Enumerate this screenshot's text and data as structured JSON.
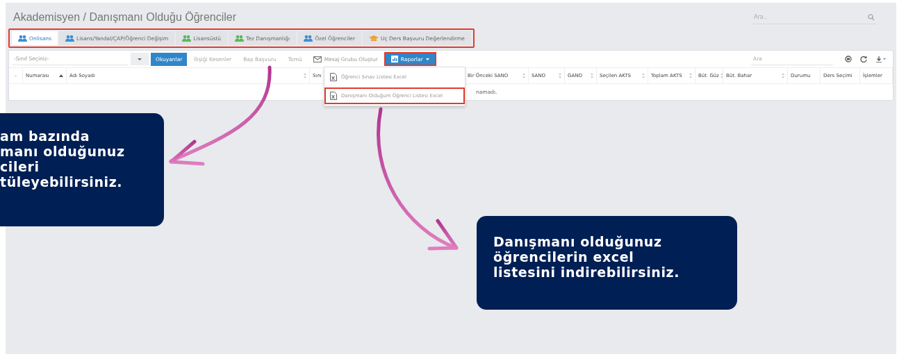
{
  "page_title": "Akademisyen / Danışmanı Olduğu Öğrenciler",
  "top_search": {
    "placeholder": "Ara.."
  },
  "tab_bar": {
    "highlighted": true,
    "tabs": [
      {
        "label": "Onlisans",
        "selected": true,
        "kind": "people",
        "color": "#3a8fd8"
      },
      {
        "label": "Lisans/Yandal/ÇAP/Öğrenci Değişim",
        "selected": false,
        "kind": "people",
        "color": "#3a8fd8"
      },
      {
        "label": "Lisansüstü",
        "selected": false,
        "kind": "people",
        "color": "#5cb85c"
      },
      {
        "label": "Tez Danışmanlığı",
        "selected": false,
        "kind": "people",
        "color": "#5cb85c"
      },
      {
        "label": "Özel Öğrenciler",
        "selected": false,
        "kind": "people",
        "color": "#3a8fd8"
      },
      {
        "label": "Uç Ders Başvuru Değerlendirme",
        "selected": false,
        "kind": "hat",
        "color": "#f0a030"
      }
    ]
  },
  "toolbar": {
    "class_select": {
      "placeholder": "-Sınıf Seçiniz-"
    },
    "filters": [
      {
        "label": "Okuyanlar",
        "selected": true
      },
      {
        "label": "İlişiği Kesenler",
        "selected": false
      },
      {
        "label": "Bap Başvuru",
        "selected": false
      },
      {
        "label": "Tomü",
        "selected": false
      }
    ],
    "message_button": "Mesaj Grubu Oluştur",
    "reports_button": {
      "label": "Raporlar",
      "highlighted": true,
      "expanded": true
    },
    "search": {
      "placeholder": "Ara"
    }
  },
  "reports_menu": [
    {
      "label": "Öğrenci Sınav Listesi Excel",
      "highlighted": false
    },
    {
      "label": "Danışmanı Olduğum Öğrenci Listesi Excel",
      "highlighted": true
    }
  ],
  "table": {
    "select_toggle": "–",
    "columns": [
      {
        "label": "Numarası",
        "sorted_ascending": true
      },
      {
        "label": "Adı Soyadı",
        "sortable": true,
        "sorted_ascending": false
      },
      {
        "label": "Sını"
      },
      {
        "label": "Bir Önceki SANO",
        "sortable": true,
        "sorted_ascending": false
      },
      {
        "label": "SANO",
        "sortable": true,
        "sorted_ascending": false
      },
      {
        "label": "GANO",
        "sortable": true,
        "sorted_ascending": false
      },
      {
        "label": "Seçilen AKTS",
        "sortable": true,
        "sorted_ascending": false
      },
      {
        "label": "Toplam AKTS",
        "sortable": true,
        "sorted_ascending": false
      },
      {
        "label": "Büt. Güz",
        "sortable": true,
        "sorted_ascending": false
      },
      {
        "label": "Büt. Bahar",
        "sortable": true,
        "sorted_ascending": false
      },
      {
        "label": "Durumu",
        "sortable": false
      },
      {
        "label": "Ders Seçimi",
        "sortable": false
      },
      {
        "label": "İşlemler",
        "sortable": false
      }
    ],
    "empty_message": "namadı."
  },
  "callouts": [
    {
      "text": "am bazında\nmanı olduğunuz\ncileri\ntüleyebilirsiniz."
    },
    {
      "text": "Danışmanı olduğunuz\nöğrencilerin excel\nlistesini indirebilirsiniz."
    }
  ]
}
